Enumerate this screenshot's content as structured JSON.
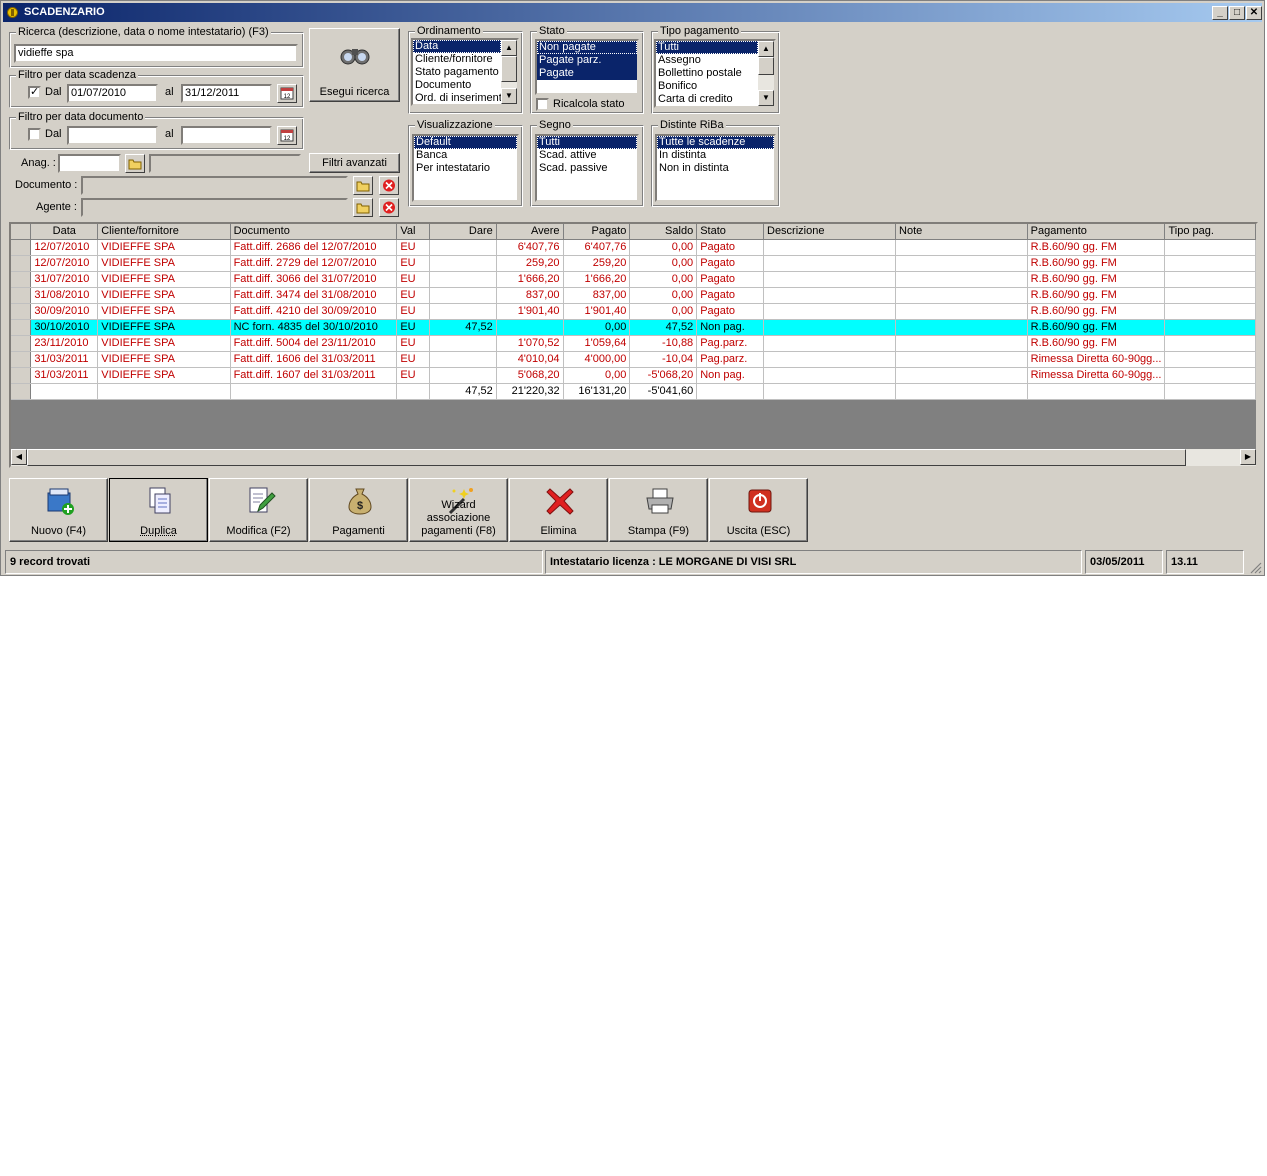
{
  "window": {
    "title": "SCADENZARIO",
    "min_label": "_",
    "max_label": "□",
    "close_label": "✕"
  },
  "search": {
    "label": "Ricerca (descrizione, data o nome intestatario) (F3)",
    "value": "vidieffe spa",
    "button_label": "Esegui ricerca"
  },
  "filter_scadenza": {
    "legend": "Filtro per data scadenza",
    "checked": true,
    "dal_label": "Dal",
    "from": "01/07/2010",
    "al_label": "al",
    "to": "31/12/2011"
  },
  "filter_documento": {
    "legend": "Filtro per data documento",
    "checked": false,
    "dal_label": "Dal",
    "from": "",
    "al_label": "al",
    "to": ""
  },
  "anag": {
    "label": "Anag. :",
    "code": "",
    "name": "",
    "filters_button": "Filtri avanzati"
  },
  "documento": {
    "label": "Documento :",
    "value": ""
  },
  "agente": {
    "label": "Agente :",
    "value": ""
  },
  "ordinamento": {
    "legend": "Ordinamento",
    "items": [
      "Data",
      "Cliente/fornitore",
      "Stato pagamento",
      "Documento",
      "Ord. di inserimento"
    ],
    "selected": [
      0
    ]
  },
  "stato": {
    "legend": "Stato",
    "items": [
      "Non pagate",
      "Pagate parz.",
      "Pagate"
    ],
    "selected": [
      0,
      1,
      2
    ],
    "ricalcola_label": "Ricalcola stato",
    "ricalcola_checked": false
  },
  "tipo_pagamento": {
    "legend": "Tipo pagamento",
    "items": [
      "Tutti",
      "Assegno",
      "Bollettino postale",
      "Bonifico",
      "Carta di credito"
    ],
    "selected": [
      0
    ]
  },
  "visualizzazione": {
    "legend": "Visualizzazione",
    "items": [
      "Default",
      "Banca",
      "Per intestatario"
    ],
    "selected": [
      0
    ]
  },
  "segno": {
    "legend": "Segno",
    "items": [
      "Tutti",
      "Scad. attive",
      "Scad. passive"
    ],
    "selected": [
      0
    ]
  },
  "distinte": {
    "legend": "Distinte RiBa",
    "items": [
      "Tutte le scadenze",
      "In distinta",
      "Non in distinta"
    ],
    "selected": [
      0
    ]
  },
  "grid": {
    "columns": [
      "Data",
      "Cliente/fornitore",
      "Documento",
      "Val",
      "Dare",
      "Avere",
      "Pagato",
      "Saldo",
      "Stato",
      "Descrizione",
      "Note",
      "Pagamento",
      "Tipo pag."
    ],
    "rows": [
      [
        "12/07/2010",
        "VIDIEFFE SPA",
        "Fatt.diff. 2686 del 12/07/2010",
        "EU",
        "",
        "6'407,76",
        "6'407,76",
        "0,00",
        "Pagato",
        "",
        "",
        "R.B.60/90 gg. FM",
        ""
      ],
      [
        "12/07/2010",
        "VIDIEFFE SPA",
        "Fatt.diff. 2729 del 12/07/2010",
        "EU",
        "",
        "259,20",
        "259,20",
        "0,00",
        "Pagato",
        "",
        "",
        "R.B.60/90 gg. FM",
        ""
      ],
      [
        "31/07/2010",
        "VIDIEFFE SPA",
        "Fatt.diff. 3066 del 31/07/2010",
        "EU",
        "",
        "1'666,20",
        "1'666,20",
        "0,00",
        "Pagato",
        "",
        "",
        "R.B.60/90 gg. FM",
        ""
      ],
      [
        "31/08/2010",
        "VIDIEFFE SPA",
        "Fatt.diff. 3474 del 31/08/2010",
        "EU",
        "",
        "837,00",
        "837,00",
        "0,00",
        "Pagato",
        "",
        "",
        "R.B.60/90 gg. FM",
        ""
      ],
      [
        "30/09/2010",
        "VIDIEFFE SPA",
        "Fatt.diff. 4210 del 30/09/2010",
        "EU",
        "",
        "1'901,40",
        "1'901,40",
        "0,00",
        "Pagato",
        "",
        "",
        "R.B.60/90 gg. FM",
        ""
      ],
      [
        "30/10/2010",
        "VIDIEFFE SPA",
        "NC forn. 4835 del 30/10/2010",
        "EU",
        "47,52",
        "",
        "0,00",
        "47,52",
        "Non pag.",
        "",
        "",
        "R.B.60/90 gg. FM",
        ""
      ],
      [
        "23/11/2010",
        "VIDIEFFE SPA",
        "Fatt.diff. 5004 del 23/11/2010",
        "EU",
        "",
        "1'070,52",
        "1'059,64",
        "-10,88",
        "Pag.parz.",
        "",
        "",
        "R.B.60/90 gg. FM",
        ""
      ],
      [
        "31/03/2011",
        "VIDIEFFE SPA",
        "Fatt.diff. 1606 del 31/03/2011",
        "EU",
        "",
        "4'010,04",
        "4'000,00",
        "-10,04",
        "Pag.parz.",
        "",
        "",
        "Rimessa Diretta 60-90gg...",
        ""
      ],
      [
        "31/03/2011",
        "VIDIEFFE SPA",
        "Fatt.diff. 1607 del 31/03/2011",
        "EU",
        "",
        "5'068,20",
        "0,00",
        "-5'068,20",
        "Non pag.",
        "",
        "",
        "Rimessa Diretta 60-90gg...",
        ""
      ]
    ],
    "highlighted_row": 5,
    "totals": [
      "",
      "",
      "",
      "",
      "47,52",
      "21'220,32",
      "16'131,20",
      "-5'041,60",
      "",
      "",
      "",
      "",
      ""
    ]
  },
  "toolbar": [
    {
      "name": "nuovo-button",
      "icon": "new-record-icon",
      "label": "Nuovo (F4)"
    },
    {
      "name": "duplica-button",
      "icon": "duplicate-icon",
      "label": "Duplica"
    },
    {
      "name": "modifica-button",
      "icon": "edit-icon",
      "label": "Modifica (F2)"
    },
    {
      "name": "pagamenti-button",
      "icon": "money-bag-icon",
      "label": "Pagamenti"
    },
    {
      "name": "wizard-button",
      "icon": "magic-wand-icon",
      "label": "Wizard\nassociazione\npagamenti (F8)"
    },
    {
      "name": "elimina-button",
      "icon": "delete-x-icon",
      "label": "Elimina"
    },
    {
      "name": "stampa-button",
      "icon": "printer-icon",
      "label": "Stampa (F9)"
    },
    {
      "name": "uscita-button",
      "icon": "exit-icon",
      "label": "Uscita (ESC)"
    }
  ],
  "statusbar": {
    "records": "9 record trovati",
    "licensee": "Intestatario licenza : LE MORGANE DI VISI SRL",
    "date": "03/05/2011",
    "time": "13.11"
  },
  "colors": {
    "title_start": "#0a246a",
    "title_end": "#a6caf0",
    "selection": "#0a246a",
    "highlight_row": "#00ffff",
    "row_text": "#c00000",
    "face": "#d4d0c8"
  }
}
